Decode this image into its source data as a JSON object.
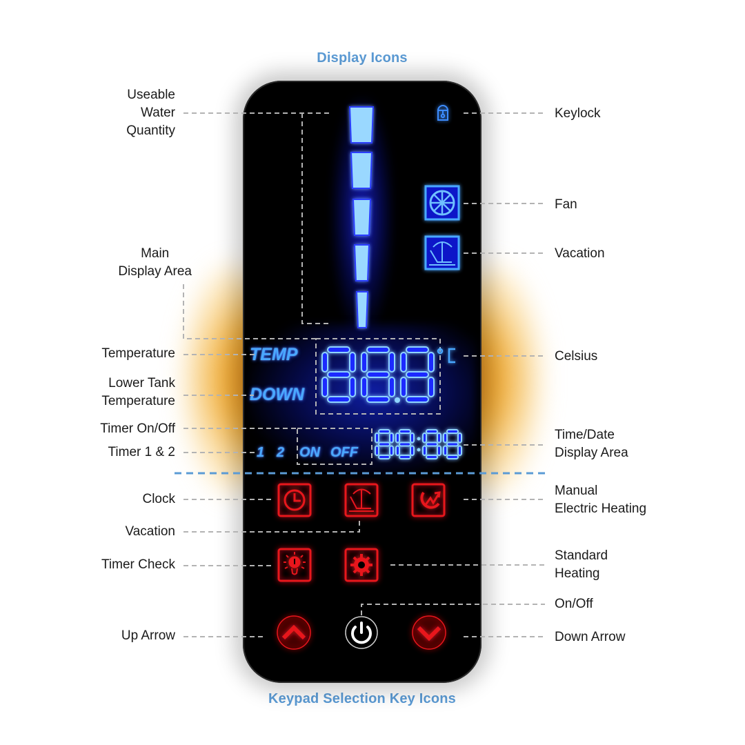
{
  "headings": {
    "top": "Display Icons",
    "bottom": "Keypad Selection Key Icons"
  },
  "colors": {
    "heading": "#5b9bd5",
    "lcd_blue": "#4aa8ff",
    "lcd_segment": "#9ad8ff",
    "key_red": "#e8141c",
    "glow_orange": "#eea62a",
    "leader_gray": "#b3b3b3",
    "separator_blue": "#5b9bd5"
  },
  "labels_left": [
    {
      "id": "useable-water-quantity",
      "text": "Useable\nWater\nQuantity"
    },
    {
      "id": "main-display-area",
      "text": "Main\nDisplay Area"
    },
    {
      "id": "temperature",
      "text": "Temperature"
    },
    {
      "id": "lower-tank-temperature",
      "text": "Lower Tank\nTemperature"
    },
    {
      "id": "timer-on-off",
      "text": "Timer On/Off"
    },
    {
      "id": "timer-1-2",
      "text": "Timer 1 & 2"
    },
    {
      "id": "clock",
      "text": "Clock"
    },
    {
      "id": "vacation-key",
      "text": "Vacation"
    },
    {
      "id": "timer-check",
      "text": "Timer Check"
    },
    {
      "id": "up-arrow",
      "text": "Up Arrow"
    }
  ],
  "labels_right": [
    {
      "id": "keylock",
      "text": "Keylock"
    },
    {
      "id": "fan",
      "text": "Fan"
    },
    {
      "id": "vacation-display",
      "text": "Vacation"
    },
    {
      "id": "celsius",
      "text": "Celsius"
    },
    {
      "id": "time-date-display-area",
      "text": "Time/Date\nDisplay Area"
    },
    {
      "id": "manual-electric-heating",
      "text": "Manual\nElectric Heating"
    },
    {
      "id": "standard-heating",
      "text": "Standard\nHeating"
    },
    {
      "id": "on-off",
      "text": "On/Off"
    },
    {
      "id": "down-arrow",
      "text": "Down Arrow"
    }
  ],
  "display": {
    "temp_label": "TEMP",
    "down_label": "DOWN",
    "temperature_readout": "88.8",
    "degree_unit": "°C",
    "timer_numbers": [
      "1",
      "2"
    ],
    "timer_on": "ON",
    "timer_off": "OFF",
    "time_readout": "88:88",
    "water_level_segments_lit": 5,
    "water_level_segments_total": 5,
    "icons": [
      "keylock-icon",
      "fan-icon",
      "vacation-umbrella-icon"
    ]
  },
  "keypad": {
    "row1": [
      "clock-icon",
      "vacation-umbrella-icon",
      "manual-heating-icon"
    ],
    "row2": [
      "timer-check-bulb-icon",
      "standard-heating-gear-icon"
    ],
    "row3": [
      "up-arrow-icon",
      "power-icon",
      "down-arrow-icon"
    ]
  }
}
